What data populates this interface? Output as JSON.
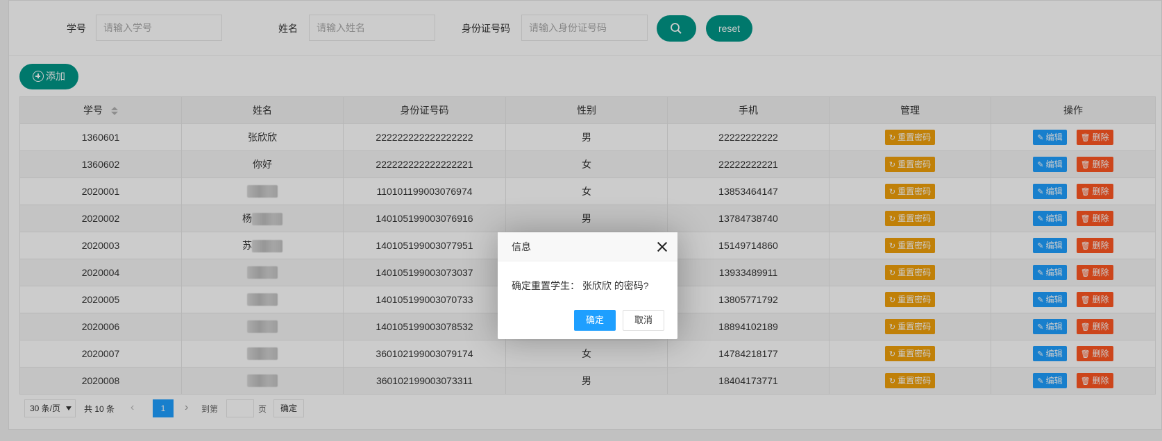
{
  "search": {
    "student_no_label": "学号",
    "student_no_placeholder": "请输入学号",
    "name_label": "姓名",
    "name_placeholder": "请输入姓名",
    "id_label": "身份证号码",
    "id_placeholder": "请输入身份证号码",
    "reset_label": "reset"
  },
  "toolbar": {
    "add_label": "添加"
  },
  "table": {
    "headers": [
      "学号",
      "姓名",
      "身份证号码",
      "性别",
      "手机",
      "管理",
      "操作"
    ],
    "reset_pwd_label": "重置密码",
    "edit_label": "编辑",
    "delete_label": "删除",
    "rows": [
      {
        "no": "1360601",
        "name": "张欣欣",
        "id": "222222222222222222",
        "gender": "男",
        "phone": "22222222222"
      },
      {
        "no": "1360602",
        "name": "你好",
        "id": "222222222222222221",
        "gender": "女",
        "phone": "22222222221"
      },
      {
        "no": "2020001",
        "name": "",
        "id": "110101199003076974",
        "gender": "女",
        "phone": "13853464147"
      },
      {
        "no": "2020002",
        "name": "杨",
        "id": "140105199003076916",
        "gender": "男",
        "phone": "13784738740"
      },
      {
        "no": "2020003",
        "name": "苏",
        "id": "140105199003077951",
        "gender": "",
        "phone": "15149714860"
      },
      {
        "no": "2020004",
        "name": "",
        "id": "140105199003073037",
        "gender": "",
        "phone": "13933489911"
      },
      {
        "no": "2020005",
        "name": "",
        "id": "140105199003070733",
        "gender": "",
        "phone": "13805771792"
      },
      {
        "no": "2020006",
        "name": "",
        "id": "140105199003078532",
        "gender": "",
        "phone": "18894102189"
      },
      {
        "no": "2020007",
        "name": "",
        "id": "360102199003079174",
        "gender": "女",
        "phone": "14784218177"
      },
      {
        "no": "2020008",
        "name": "",
        "id": "360102199003073311",
        "gender": "男",
        "phone": "18404173771"
      }
    ]
  },
  "pager": {
    "limit": "30 条/页",
    "count": "共 10 条",
    "current": "1",
    "goto_label": "到第",
    "page_unit": "页",
    "confirm_label": "确定"
  },
  "modal": {
    "title": "信息",
    "message": "确定重置学生： 张欣欣 的密码?",
    "ok_label": "确定",
    "cancel_label": "取消"
  },
  "colors": {
    "primary": "#009688",
    "blue": "#1e9fff",
    "warn": "#f0a10a",
    "danger": "#ff5722"
  }
}
